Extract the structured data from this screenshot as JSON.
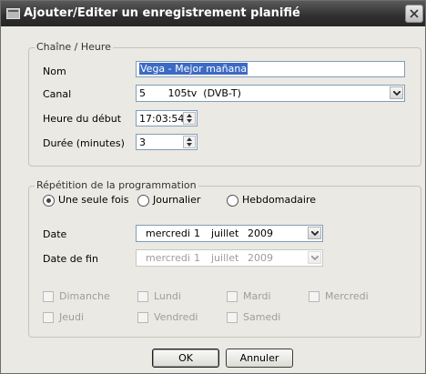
{
  "window": {
    "title": "Ajouter/Editer un enregistrement planifié"
  },
  "channel_group": {
    "legend": "Chaîne / Heure",
    "name_label": "Nom",
    "name_value": "Vega - Mejor mañana",
    "channel_label": "Canal",
    "channel_value": "5       105tv  (DVB-T)",
    "start_label": "Heure du début",
    "start_value": "17:03:54",
    "duration_label": "Durée (minutes)",
    "duration_value": "3"
  },
  "repeat_group": {
    "legend": "Répétition de la programmation",
    "options": [
      {
        "label": "Une seule fois",
        "selected": true
      },
      {
        "label": "Journalier",
        "selected": false
      },
      {
        "label": "Hebdomadaire",
        "selected": false
      }
    ],
    "date_label": "Date",
    "date": {
      "weekday": "mercredi",
      "day": "1",
      "month": "juillet",
      "year": "2009"
    },
    "end_date_label": "Date de fin",
    "end_date": {
      "weekday": "mercredi",
      "day": "1",
      "month": "juillet",
      "year": "2009"
    },
    "days": [
      {
        "label": "Dimanche",
        "checked": false
      },
      {
        "label": "Lundi",
        "checked": false
      },
      {
        "label": "Mardi",
        "checked": false
      },
      {
        "label": "Mercredi",
        "checked": false
      },
      {
        "label": "Jeudi",
        "checked": false
      },
      {
        "label": "Vendredi",
        "checked": false
      },
      {
        "label": "Samedi",
        "checked": false
      }
    ]
  },
  "buttons": {
    "ok": "OK",
    "cancel": "Annuler"
  },
  "icons": {
    "window": "window-icon",
    "close": "close-icon",
    "spin": "spin-icon",
    "dropdown": "chevron-down-icon"
  },
  "colors": {
    "titlebar": "#2f2f2f",
    "selection": "#3c6ac4",
    "dialog": "#ebe9e3"
  }
}
